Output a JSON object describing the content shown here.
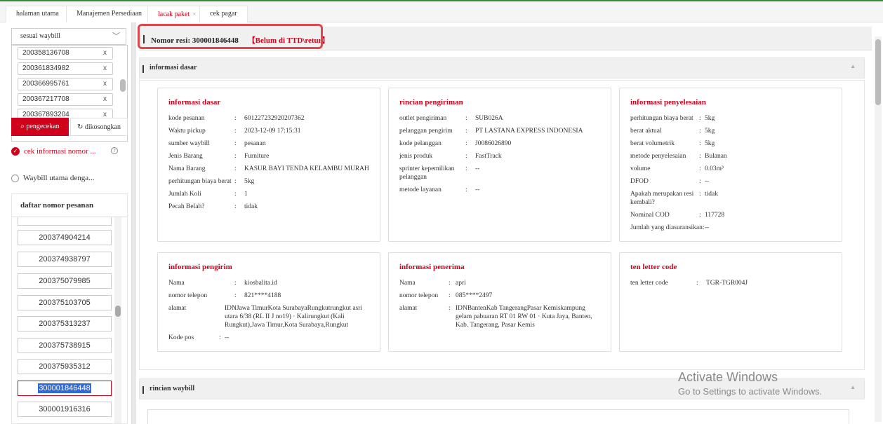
{
  "tabs": [
    {
      "label": "halaman utama",
      "active": false
    },
    {
      "label": "Manajemen Persediaan",
      "active": false
    },
    {
      "label": "lacak paket",
      "active": true,
      "close": "×"
    },
    {
      "label": "cek pagar",
      "active": false
    }
  ],
  "sidebar": {
    "search_mode": "sesuai waybill",
    "waybills": [
      "200358136708",
      "200361834982",
      "200366995761",
      "200367217708",
      "200367893204"
    ],
    "search_button": "pengecekan",
    "clear_button": "dikosongkan",
    "option_check": "cek informasi nomor ...",
    "option_main": "Waybill utama denga...",
    "list_title": "daftar nomor pesanan",
    "orders": [
      "200374904214",
      "200374938797",
      "200375079985",
      "200375103705",
      "200375313237",
      "200375738915",
      "200375935312",
      "300001846448",
      "300001916316"
    ],
    "selected_order": "300001846448"
  },
  "main": {
    "resi_label": "Nomor resi:",
    "resi_number": "300001846448",
    "resi_status": "【Belum di TTD\\retur】",
    "section_basic": "informasi dasar",
    "section_waybill": "rincian waybill",
    "cards": {
      "basic": {
        "title": "informasi dasar",
        "rows": [
          {
            "label": "kode pesanan",
            "value": "601227232920207362"
          },
          {
            "label": "Waktu pickup",
            "value": "2023-12-09 17:15:31"
          },
          {
            "label": "sumber waybill",
            "value": "pesanan"
          },
          {
            "label": "Jenis Barang",
            "value": "Furniture"
          },
          {
            "label": "Nama Barang",
            "value": "KASUR BAYI TENDA KELAMBU MURAH"
          },
          {
            "label": "perhitungan biaya berat",
            "value": "5kg"
          },
          {
            "label": "Jumlah Koli",
            "value": "1"
          },
          {
            "label": "Pecah Belah?",
            "value": "tidak"
          }
        ]
      },
      "shipping": {
        "title": "rincian pengiriman",
        "rows": [
          {
            "label": "outlet pengiriman",
            "value": "SUB026A"
          },
          {
            "label": "pelanggan pengirim",
            "value": "PT LASTANA EXPRESS INDONESIA"
          },
          {
            "label": "kode pelanggan",
            "value": "J0086026890"
          },
          {
            "label": "jenis produk",
            "value": "FastTrack"
          },
          {
            "label": "sprinter kepemilikan pelanggan",
            "value": "--"
          },
          {
            "label": "metode layanan",
            "value": "--"
          }
        ]
      },
      "settlement": {
        "title": "informasi penyelesaian",
        "rows": [
          {
            "label": "perhitungan biaya berat",
            "value": "5kg"
          },
          {
            "label": "berat aktual",
            "value": "5kg"
          },
          {
            "label": "berat volumetrik",
            "value": "5kg"
          },
          {
            "label": "metode penyelesaian",
            "value": "Bulanan"
          },
          {
            "label": "volume",
            "value": "0.03m³"
          },
          {
            "label": "DFOD",
            "value": "--"
          },
          {
            "label": "Apakah merupakan resi kembali?",
            "value": "tidak"
          },
          {
            "label": "Nominal COD",
            "value": "117728"
          },
          {
            "label": "Jumlah yang diasuransikan:",
            "value": "--"
          }
        ]
      },
      "sender": {
        "title": "informasi pengirim",
        "rows": [
          {
            "label": "Nama",
            "value": "kiosbalita.id"
          },
          {
            "label": "nomor telepon",
            "value": "821****4188"
          },
          {
            "label": "alamat",
            "value": "IDNJawa TimurKota SurabayaRungkutrungkut asri utara 6/38 (RL II J no19) · Kalirungkut (Kali Rungkut),Jawa Timur,Kota Surabaya,Rungkut"
          },
          {
            "label": "Kode pos",
            "value": "--"
          }
        ]
      },
      "receiver": {
        "title": "informasi penerima",
        "rows": [
          {
            "label": "Nama",
            "value": "apri"
          },
          {
            "label": "nomor telepon",
            "value": "085****2497"
          },
          {
            "label": "alamat",
            "value": "IDNBantenKab TangerangPasar Kemiskampung gelam pabuaran RT 01 RW 01 · Kuta Jaya, Banten, Kab. Tangerang, Pasar Kemis"
          }
        ]
      },
      "tencode": {
        "title": "ten letter code",
        "rows": [
          {
            "label": "ten letter code",
            "value": "TGR-TGR004J"
          }
        ]
      }
    }
  },
  "watermark": {
    "line1": "Activate Windows",
    "line2": "Go to Settings to activate Windows."
  },
  "colors": {
    "accent": "#d0021b",
    "selected_bg": "#2f6bd6"
  }
}
